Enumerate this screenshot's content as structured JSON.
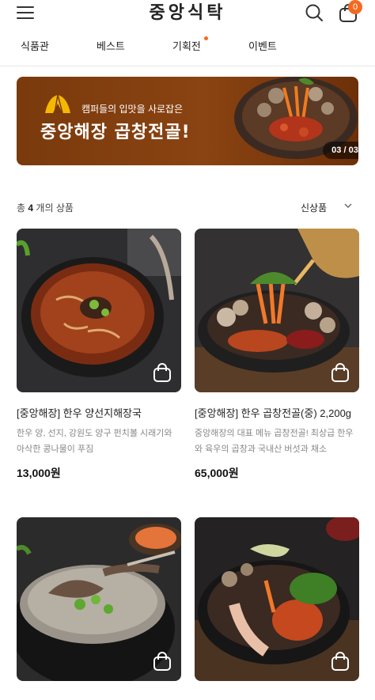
{
  "header": {
    "logo": "중앙식탁",
    "cart_count": "0",
    "icons": {
      "menu": "hamburger-menu-icon",
      "search": "search-icon",
      "cart": "shopping-bag-icon"
    }
  },
  "tabs": [
    {
      "label": "식품관",
      "has_dot": false
    },
    {
      "label": "베스트",
      "has_dot": false
    },
    {
      "label": "기획전",
      "has_dot": true
    },
    {
      "label": "이벤트",
      "has_dot": false
    }
  ],
  "banner": {
    "subtitle": "캠퍼들의 입맛을 사로잡은",
    "title": "중앙해장 곱창전골!",
    "counter": "03 / 03",
    "colors": {
      "background": "#7a3a0c",
      "icon": "#f5b800"
    }
  },
  "list": {
    "count_prefix": "총",
    "count_value": "4",
    "count_suffix": "개의 상품",
    "sort_label": "신상품"
  },
  "products": [
    {
      "name": "[중앙해장] 한우 양선지해장국",
      "desc": "한우 양, 선지, 강원도 양구 펀치볼 시래기와 아삭한 콩나물이 푸짐",
      "price": "13,000원"
    },
    {
      "name": "[중앙해장] 한우 곱창전골(중) 2,200g",
      "desc": "중앙해장의 대표 메뉴 곱창전골! 최상급 한우와 육우의 곱창과 국내산 버섯과 채소",
      "price": "65,000원"
    },
    {
      "name": "",
      "desc": "",
      "price": ""
    },
    {
      "name": "",
      "desc": "",
      "price": ""
    }
  ],
  "colors": {
    "accent": "#f26a21",
    "text": "#222222",
    "muted": "#888888"
  }
}
